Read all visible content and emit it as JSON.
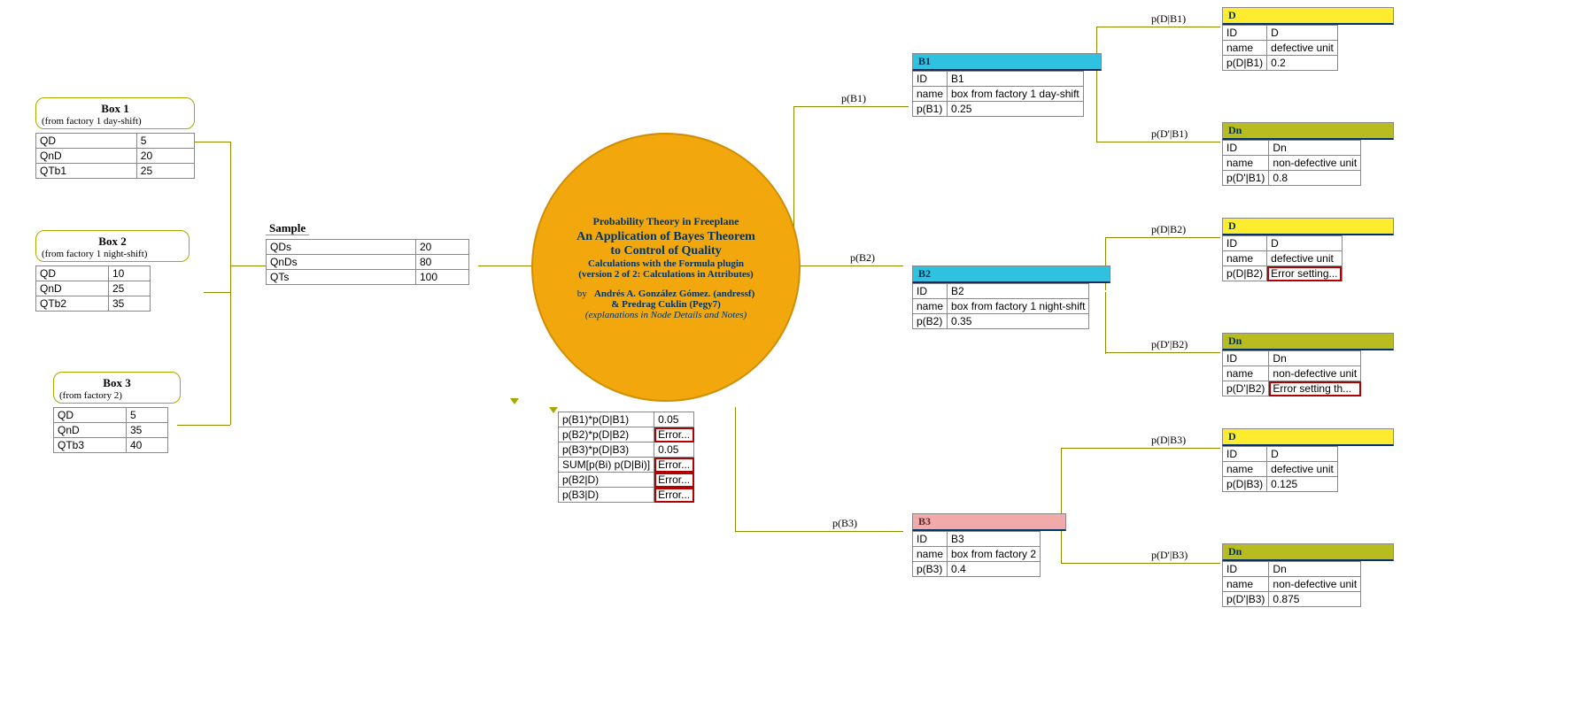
{
  "root": {
    "l1": "Probability Theory in Freeplane",
    "l2": "An Application of Bayes Theorem",
    "l3": "to Control of  Quality",
    "l4": "Calculations with the Formula plugin",
    "l5": "(version 2 of 2: Calculations in Attributes)",
    "by_prefix": "by",
    "author1": "Andrés A. González Gómez. (andressf)",
    "author2": "& Predrag Cuklin (Pegy7)",
    "note": "(explanations in Node Details and Notes)"
  },
  "box1": {
    "title": "Box 1",
    "sub": "(from factory 1 day-shift)",
    "rows": [
      [
        "QD",
        "5"
      ],
      [
        "QnD",
        "20"
      ],
      [
        "QTb1",
        "25"
      ]
    ]
  },
  "box2": {
    "title": "Box 2",
    "sub": "(from factory 1 night-shift)",
    "rows": [
      [
        "QD",
        "10"
      ],
      [
        "QnD",
        "25"
      ],
      [
        "QTb2",
        "35"
      ]
    ]
  },
  "box3": {
    "title": "Box 3",
    "sub": "(from factory 2)",
    "rows": [
      [
        "QD",
        "5"
      ],
      [
        "QnD",
        "35"
      ],
      [
        "QTb3",
        "40"
      ]
    ]
  },
  "sample": {
    "label": "Sample",
    "rows": [
      [
        "QDs",
        "20"
      ],
      [
        "QnDs",
        "80"
      ],
      [
        "QTs",
        "100"
      ]
    ]
  },
  "calc": {
    "rows": [
      [
        "p(B1)*p(D|B1)",
        "0.05",
        false
      ],
      [
        "p(B2)*p(D|B2)",
        "Error...",
        true
      ],
      [
        "p(B3)*p(D|B3)",
        "0.05",
        false
      ],
      [
        "SUM[p(Bi) p(D|Bi)]",
        "Error...",
        true
      ],
      [
        "p(B2|D)",
        "Error...",
        true
      ],
      [
        "p(B3|D)",
        "Error...",
        true
      ]
    ]
  },
  "edges": {
    "b1": "p(B1)",
    "b2": "p(B2)",
    "b3": "p(B3)",
    "d_b1": "p(D|B1)",
    "dn_b1": "p(D'|B1)",
    "d_b2": "p(D|B2)",
    "dn_b2": "p(D'|B2)",
    "d_b3": "p(D|B3)",
    "dn_b3": "p(D'|B3)"
  },
  "b1": {
    "title": "B1",
    "rows": [
      [
        "ID",
        "B1"
      ],
      [
        "name",
        "box from factory 1 day-shift"
      ],
      [
        "p(B1)",
        "0.25"
      ]
    ]
  },
  "b2": {
    "title": "B2",
    "rows": [
      [
        "ID",
        "B2"
      ],
      [
        "name",
        "box from factory 1 night-shift"
      ],
      [
        "p(B2)",
        "0.35"
      ]
    ]
  },
  "b3": {
    "title": "B3",
    "rows": [
      [
        "ID",
        "B3"
      ],
      [
        "name",
        "box from factory 2"
      ],
      [
        "p(B3)",
        "0.4"
      ]
    ]
  },
  "b1_d": {
    "title": "D",
    "rows": [
      [
        "ID",
        "D"
      ],
      [
        "name",
        "defective unit"
      ],
      [
        "p(D|B1)",
        "0.2"
      ]
    ]
  },
  "b1_dn": {
    "title": "Dn",
    "rows": [
      [
        "ID",
        "Dn"
      ],
      [
        "name",
        "non-defective unit"
      ],
      [
        "p(D'|B1)",
        "0.8"
      ]
    ]
  },
  "b2_d": {
    "title": "D",
    "rows": [
      [
        "ID",
        "D"
      ],
      [
        "name",
        "defective unit"
      ],
      [
        "p(D|B2)",
        "Error setting..."
      ]
    ],
    "error_row": 2
  },
  "b2_dn": {
    "title": "Dn",
    "rows": [
      [
        "ID",
        "Dn"
      ],
      [
        "name",
        "non-defective unit"
      ],
      [
        "p(D'|B2)",
        "Error setting th..."
      ]
    ],
    "error_row": 2
  },
  "b3_d": {
    "title": "D",
    "rows": [
      [
        "ID",
        "D"
      ],
      [
        "name",
        "defective unit"
      ],
      [
        "p(D|B3)",
        "0.125"
      ]
    ]
  },
  "b3_dn": {
    "title": "Dn",
    "rows": [
      [
        "ID",
        "Dn"
      ],
      [
        "name",
        "non-defective unit"
      ],
      [
        "p(D'|B3)",
        "0.875"
      ]
    ]
  }
}
